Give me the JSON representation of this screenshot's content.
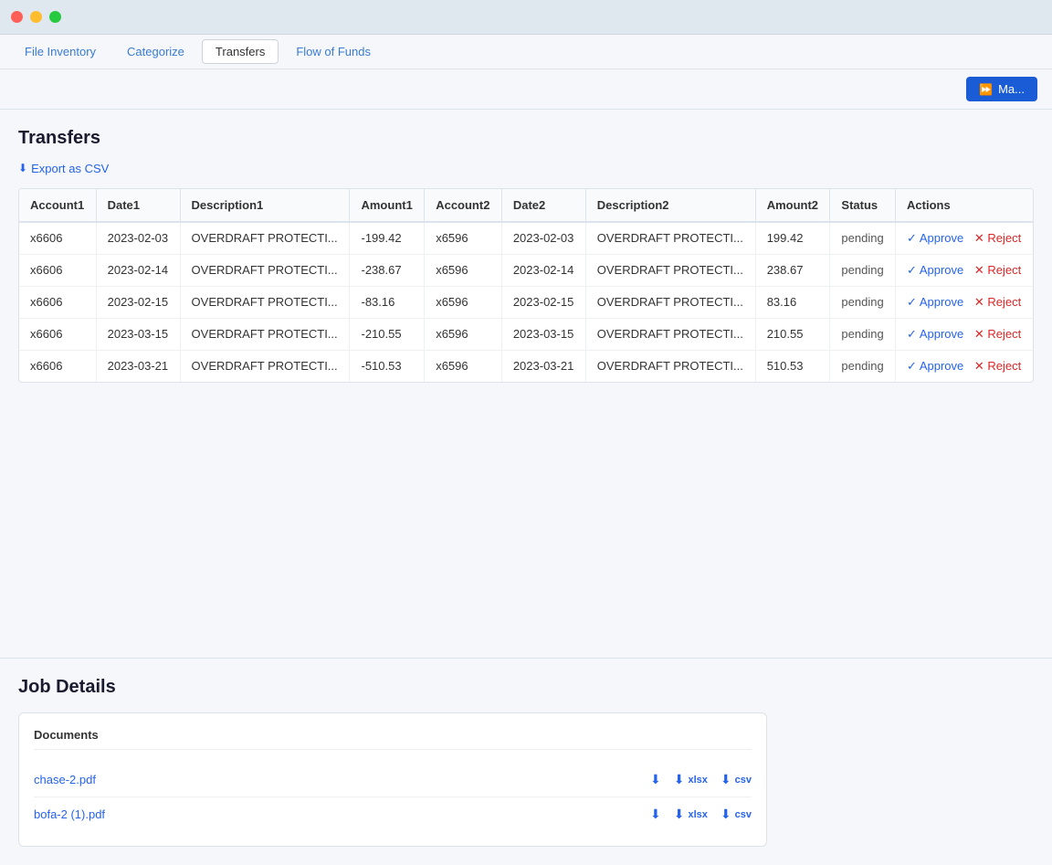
{
  "titlebar": {
    "lights": [
      "red",
      "yellow",
      "green"
    ]
  },
  "tabs": [
    {
      "id": "file-inventory",
      "label": "File Inventory",
      "active": false
    },
    {
      "id": "categorize",
      "label": "Categorize",
      "active": false
    },
    {
      "id": "transfers",
      "label": "Transfers",
      "active": true
    },
    {
      "id": "flow-of-funds",
      "label": "Flow of Funds",
      "active": false
    }
  ],
  "toolbar": {
    "match_button_label": "Ma..."
  },
  "transfers": {
    "title": "Transfers",
    "export_label": "Export as CSV",
    "columns": [
      "Account1",
      "Date1",
      "Description1",
      "Amount1",
      "Account2",
      "Date2",
      "Description2",
      "Amount2",
      "Status",
      "Actions"
    ],
    "rows": [
      {
        "account1": "x6606",
        "date1": "2023-02-03",
        "description1": "OVERDRAFT PROTECTI...",
        "amount1": "-199.42",
        "account2": "x6596",
        "date2": "2023-02-03",
        "description2": "OVERDRAFT PROTECTI...",
        "amount2": "199.42",
        "status": "pending",
        "approve_label": "Approve",
        "reject_label": "Reject"
      },
      {
        "account1": "x6606",
        "date1": "2023-02-14",
        "description1": "OVERDRAFT PROTECTI...",
        "amount1": "-238.67",
        "account2": "x6596",
        "date2": "2023-02-14",
        "description2": "OVERDRAFT PROTECTI...",
        "amount2": "238.67",
        "status": "pending",
        "approve_label": "Approve",
        "reject_label": "Reject"
      },
      {
        "account1": "x6606",
        "date1": "2023-02-15",
        "description1": "OVERDRAFT PROTECTI...",
        "amount1": "-83.16",
        "account2": "x6596",
        "date2": "2023-02-15",
        "description2": "OVERDRAFT PROTECTI...",
        "amount2": "83.16",
        "status": "pending",
        "approve_label": "Approve",
        "reject_label": "Reject"
      },
      {
        "account1": "x6606",
        "date1": "2023-03-15",
        "description1": "OVERDRAFT PROTECTI...",
        "amount1": "-210.55",
        "account2": "x6596",
        "date2": "2023-03-15",
        "description2": "OVERDRAFT PROTECTI...",
        "amount2": "210.55",
        "status": "pending",
        "approve_label": "Approve",
        "reject_label": "Reject"
      },
      {
        "account1": "x6606",
        "date1": "2023-03-21",
        "description1": "OVERDRAFT PROTECTI...",
        "amount1": "-510.53",
        "account2": "x6596",
        "date2": "2023-03-21",
        "description2": "OVERDRAFT PROTECTI...",
        "amount2": "510.53",
        "status": "pending",
        "approve_label": "Approve",
        "reject_label": "Reject"
      }
    ]
  },
  "job_details": {
    "title": "Job Details",
    "documents_title": "Documents",
    "documents": [
      {
        "name": "chase-2.pdf",
        "download_label": "⬇",
        "xlsx_label": "xlsx",
        "csv_label": "csv"
      },
      {
        "name": "bofa-2 (1).pdf",
        "download_label": "⬇",
        "xlsx_label": "xlsx",
        "csv_label": "csv"
      }
    ]
  }
}
